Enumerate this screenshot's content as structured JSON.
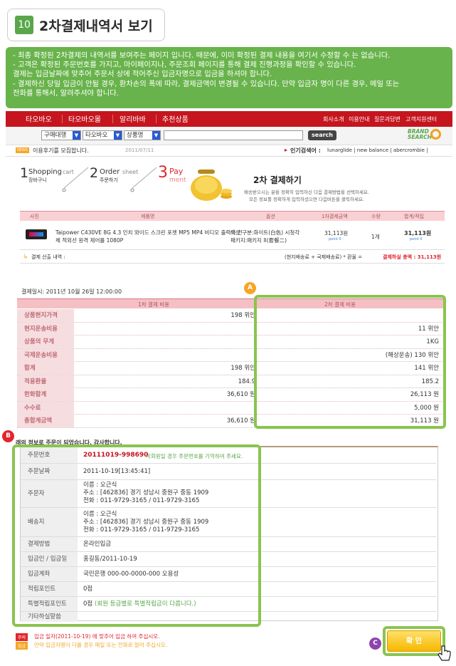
{
  "step": {
    "number": "10",
    "title": "2차결제내역서 보기"
  },
  "description": [
    "- 최종 확정된 2차결제의 내역서를 보여주는 페이지 입니다. 때문에, 이미 확정된 결제 내용을 여기서 수정할 수 는 없습니다.",
    "- 고객은 확정된 주문번호를 가지고, 마이페이지나, 주문조회 페이지를 통해 결제 진행과정을 확인할 수 있습니다.",
    "  결제는 입금날짜에 맞추어 주문서 상에 적어주신 입금자명으로 입금을 하셔야 합니다.",
    "- 결제하신 당일 입금이 안될 경우, 환차손의 폭에 따라, 결제금액이 변경될 수 있습니다.  만약 입금자 명이 다른 경우, 메일 또는",
    "  전화를 통해서, 알려주셔야 합니다."
  ],
  "nav": {
    "items": [
      "타오바오",
      "타오바오몰",
      "알리바바",
      "추천상품"
    ],
    "right": [
      "회사소개",
      "이용안내",
      "질문과답변",
      "고객지원센터"
    ]
  },
  "search": {
    "select1": "구매대행",
    "select2": "타오바오",
    "select3": "상품명",
    "button": "search",
    "brand": [
      "BRAND",
      "SEARCH"
    ]
  },
  "notice": {
    "badge": "NEWS",
    "text": "이용후기를 모집합니다.",
    "date": "2011/07/11",
    "popular_label": "인기검색어 :",
    "popular": "lunarglide | new balance | abercrombie |"
  },
  "progress": {
    "s1_num": "1",
    "s1_en": "Shopping",
    "s1_en2": "cart",
    "s1_ko": "장바구니",
    "s2_num": "2",
    "s2_en": "Order",
    "s2_en2": "sheet",
    "s2_ko": "주문하기",
    "s3_num": "3",
    "s3_en": "Pay",
    "s3_en2": "ment",
    "heading": "2차 결제하기",
    "sub1": "배송받으시는 분을 정확히 입력하신 다음 결제방법을 선택하세요.",
    "sub2": "모든 정보를 정확하게 입력하셨으면 다음버튼을 클릭하세요."
  },
  "product_table": {
    "headers": [
      "사진",
      "제품명",
      "옵션",
      "1차결제금액",
      "수량",
      "합계/적립"
    ],
    "name": "Taipower C430VE 8G 4.3 인치 와이드 스크린 포켓 MP5 MP4 비디오 출력의 전",
    "name2": "체 적외선 원격 제어를 1080P",
    "option1": "색상 구분:화이트(白色) 시청각",
    "option2": "패키지:패키지 II(套餐二)",
    "price": "31,113원",
    "price_point": "point 0",
    "qty": "1개",
    "total": "31,113원",
    "total_point": "point 0"
  },
  "calc": {
    "label": "결제 산출 내역 :",
    "formula": "(현지배송료 + 국제배송료) * 환율 =",
    "total_label": "결제하실 총액 : 31,113원"
  },
  "pay_date": "결제일시: 2011년 10월 26일    12:00:00",
  "cost_table": {
    "col1": "1차 결제 비용",
    "col2": "2차 결제 비용",
    "rows": [
      {
        "label": "상품현지가격",
        "v1": "198 위안",
        "v2": ""
      },
      {
        "label": "현지운송비용",
        "v1": "",
        "v2": "11 위안"
      },
      {
        "label": "상품의 무게",
        "v1": "",
        "v2": "1KG"
      },
      {
        "label": "국제운송비용",
        "v1": "",
        "v2": "(해상운송) 130 위안"
      },
      {
        "label": "합계",
        "v1": "198 위안",
        "v2": "141 위안"
      },
      {
        "label": "적용환율",
        "v1": "184.9",
        "v2": "185.2"
      },
      {
        "label": "한화합계",
        "v1": "36,610 원",
        "v2": "26,113 원"
      },
      {
        "label": "수수료",
        "v1": "",
        "v2": "5,000 원"
      },
      {
        "label": "총합계금액",
        "v1": "36,610 원",
        "v2": "31,113 원"
      }
    ]
  },
  "markers": {
    "a": "A",
    "b": "B",
    "c": "C"
  },
  "order_heading": "래의 정보로 주문이 되었습니다. 감사합니다.",
  "order_info": {
    "order_no_label": "주문번호",
    "order_no": "20111019-998690",
    "order_no_note": "비회원일 경우 주문번호를 기억하여 주세요.",
    "date_label": "주문날짜",
    "date": "2011-10-19[13:45:41]",
    "orderer_label": "주문자",
    "orderer": [
      "이름 : 오근식",
      "주소 : [462836] 경기 성남시 중원구 중동 1909",
      "전화 : 011-9729-3165 / 011-9729-3165"
    ],
    "receiver_label": "배송지",
    "receiver": [
      "이름 : 오근식",
      "주소 : [462836] 경기 성남시 중원구 중동 1909",
      "전화 : 011-9729-3165 / 011-9729-3165"
    ],
    "method_label": "결제방법",
    "method": "온라인입금",
    "depositor_label": "입금인 / 입금일",
    "depositor": "홍길동/2011-10-19",
    "account_label": "입금계좌",
    "account": "국민은행 000-00-0000-000 오용성",
    "points_label": "적립포인트",
    "points": "0점",
    "special_label": "특별적립포인트",
    "special": "0점",
    "special_note": "(회원 등급별로 특별적립금이 다릅니다.)",
    "memo_label": "기타하실말씀"
  },
  "footer": {
    "badge1": "주의",
    "note1": "입금 일자(2011-10-19) 에 맞추어 입금 하여 주십시오.",
    "badge2": "입금",
    "note2": "만약 입금자명이 다를 경우 메일 또는 전화로 알려 주십시오.",
    "confirm": "확 인"
  }
}
